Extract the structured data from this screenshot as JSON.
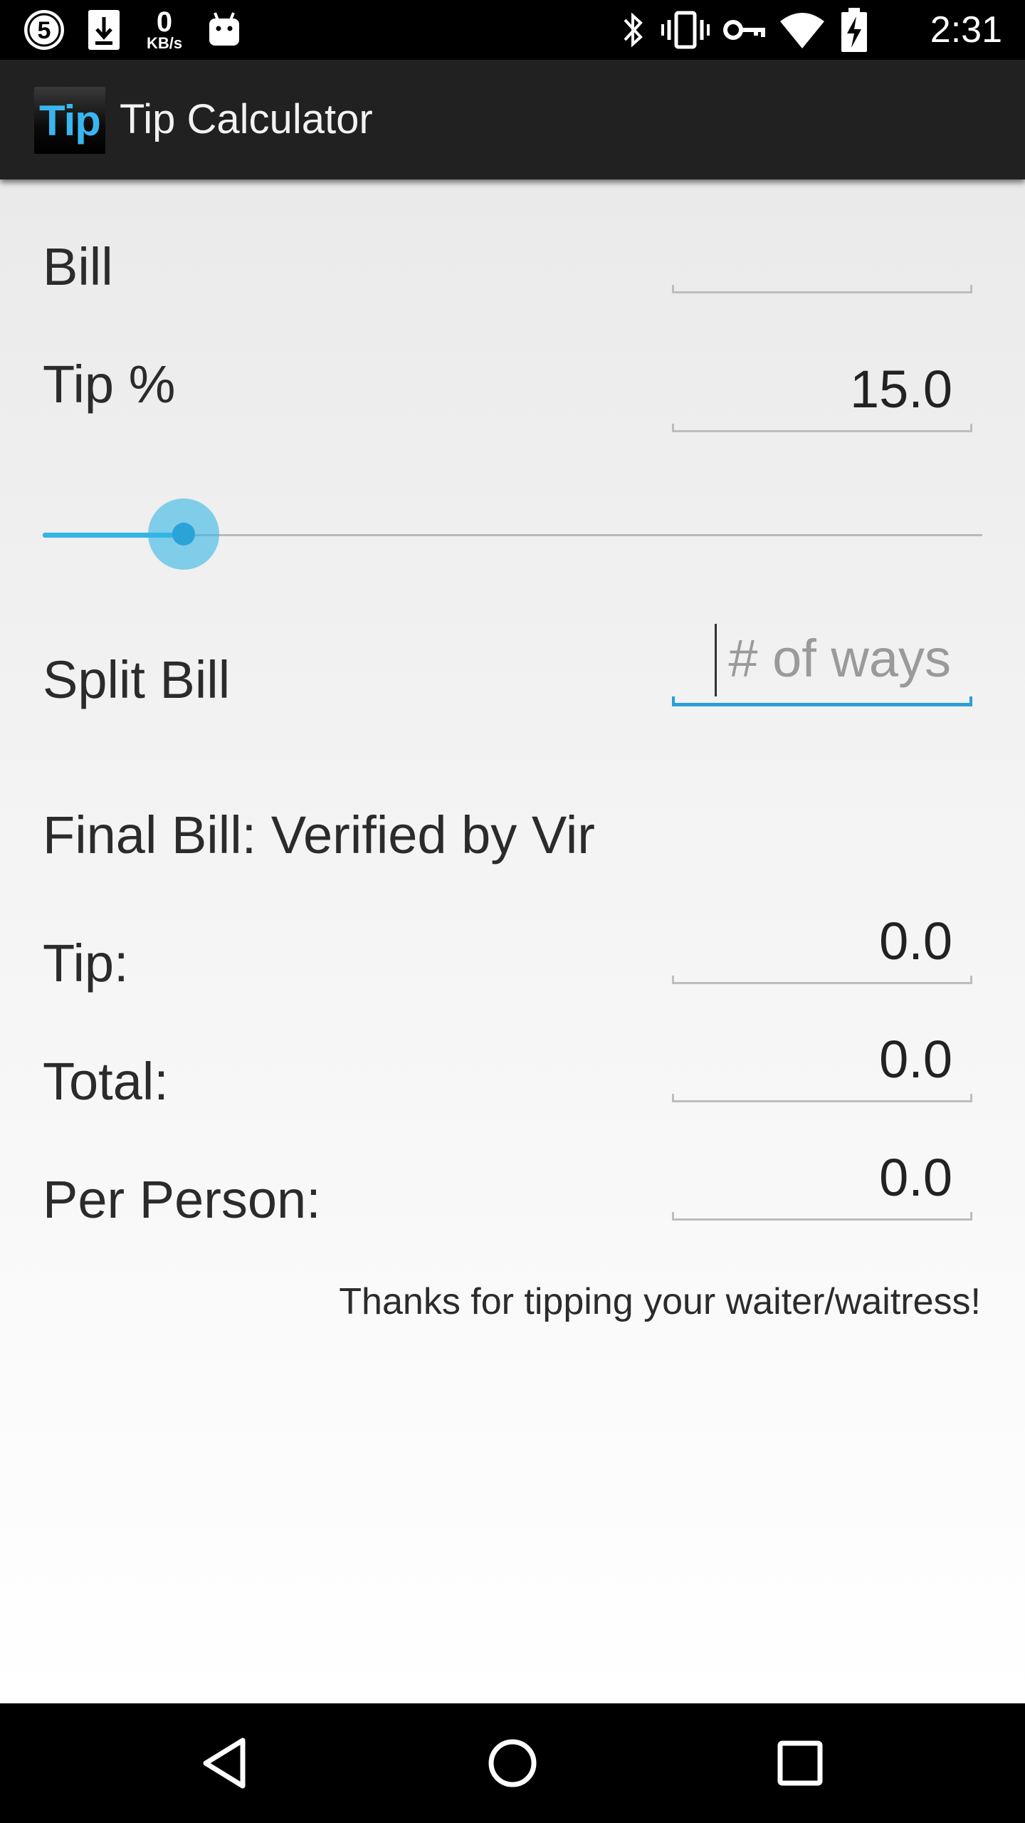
{
  "status_bar": {
    "time": "2:31",
    "net_speed_value": "0",
    "net_speed_unit": "KB/s",
    "left_icons": [
      "five-badge-icon",
      "download-icon",
      "net-speed-indicator",
      "android-icon"
    ],
    "right_icons": [
      "bluetooth-icon",
      "vibrate-icon",
      "vpn-key-icon",
      "wifi-icon",
      "battery-charging-icon"
    ]
  },
  "action_bar": {
    "logo_text": "Tip",
    "title": "Tip Calculator"
  },
  "form": {
    "bill_label": "Bill",
    "bill_value": "",
    "tip_percent_label": "Tip %",
    "tip_percent_value": "15.0",
    "tip_slider_fraction": 0.15,
    "split_label": "Split Bill",
    "split_placeholder": "# of ways"
  },
  "results": {
    "heading": "Final Bill: Verified by Vir",
    "tip_label": "Tip:",
    "tip_value": "0.0",
    "total_label": "Total:",
    "total_value": "0.0",
    "per_person_label": "Per Person:",
    "per_person_value": "0.0"
  },
  "footer_note": "Thanks for tipping your waiter/waitress!",
  "nav_bar": {
    "buttons": [
      "back-icon",
      "home-icon",
      "recents-icon"
    ]
  },
  "colors": {
    "accent": "#33b5e5",
    "action_bar": "#212121",
    "status_bar": "#000000"
  }
}
